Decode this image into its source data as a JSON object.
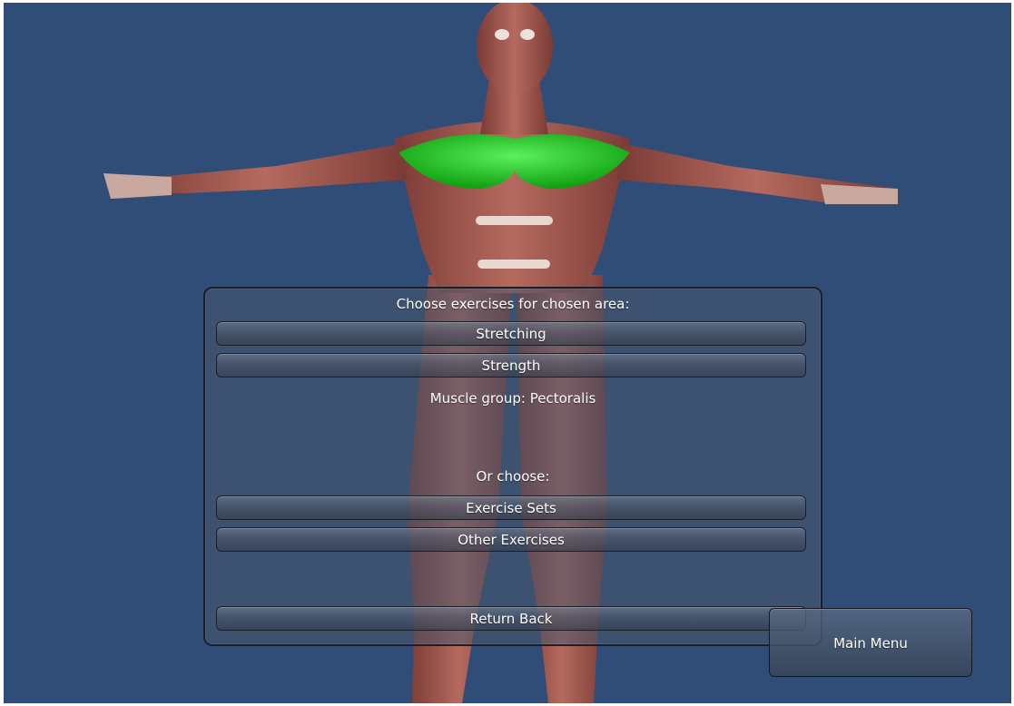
{
  "scene": {
    "background_color": "#304d77",
    "model": "anatomy-muscle-model",
    "highlight_color": "#22cc22"
  },
  "panel": {
    "heading": "Choose exercises for chosen area:",
    "buttons": {
      "stretching": "Stretching",
      "strength": "Strength",
      "exercise_sets": "Exercise Sets",
      "other_exercises": "Other Exercises",
      "return_back": "Return Back"
    },
    "muscle_group": "Muscle group: Pectoralis",
    "or_choose": "Or choose:"
  },
  "main_menu": {
    "label": "Main Menu"
  }
}
